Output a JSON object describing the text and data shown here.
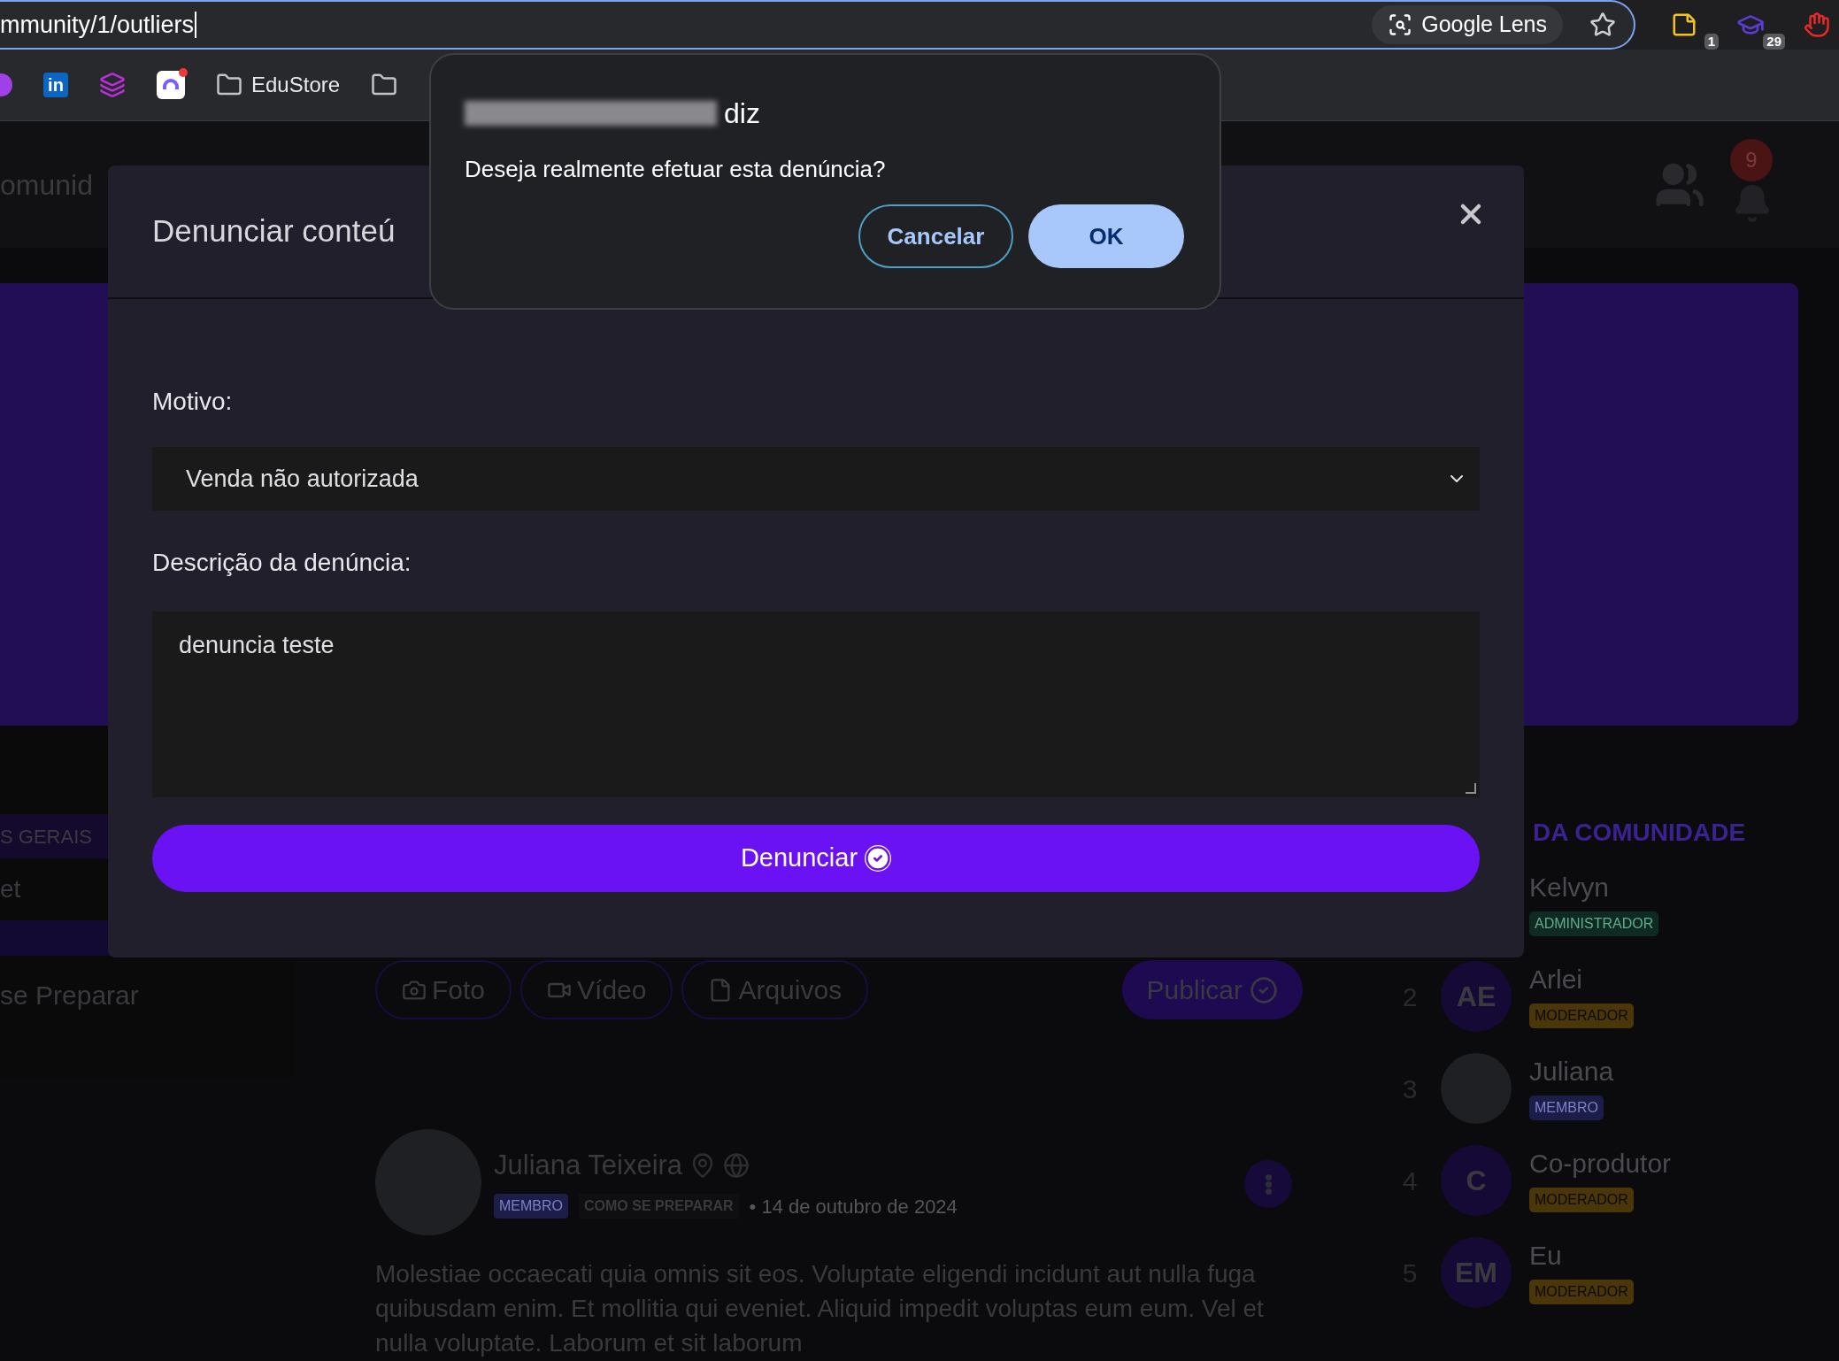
{
  "browser": {
    "url": "mmunity/1/outliers",
    "lens_label": "Google Lens",
    "extensions": [
      {
        "kind": "note",
        "badge": "1"
      },
      {
        "kind": "cap",
        "badge": "29"
      },
      {
        "kind": "hand"
      }
    ],
    "bookmarks": [
      {
        "kind": "circle"
      },
      {
        "kind": "linkedin",
        "label": "in"
      },
      {
        "kind": "layers"
      },
      {
        "kind": "clickup"
      },
      {
        "kind": "folder",
        "label": "EduStore"
      },
      {
        "kind": "folder"
      }
    ]
  },
  "header": {
    "title": "omunid",
    "notification_count": "9"
  },
  "left": {
    "section": "S GERAIS",
    "items": [
      {
        "label": "et",
        "selected": false
      },
      {
        "selected": true
      }
    ],
    "category": "se Preparar"
  },
  "composer": {
    "buttons": [
      {
        "kind": "photo",
        "label": "Foto"
      },
      {
        "kind": "video",
        "label": "Vídeo"
      },
      {
        "kind": "file",
        "label": "Arquivos"
      }
    ],
    "publish": "Publicar"
  },
  "post": {
    "author": "Juliana Teixeira",
    "role": "MEMBRO",
    "topic": "COMO SE PREPARAR",
    "date": "• 14 de outubro de 2024",
    "body": "Molestiae occaecati quia omnis sit eos. Voluptate eligendi incidunt aut nulla fuga quibusdam enim. Et mollitia qui eveniet. Aliquid impedit voluptas eum eum. Vel et nulla voluptate. Laborum et sit laborum"
  },
  "ranking": {
    "title": "DA COMUNIDADE",
    "members": [
      {
        "name": "Kelvyn",
        "role": "ADMINISTRADOR",
        "kind": "admin"
      },
      {
        "rank": "2",
        "initials": "AE",
        "name": "Arlei",
        "role": "MODERADOR",
        "kind": "moderator"
      },
      {
        "rank": "3",
        "name": "Juliana",
        "role": "MEMBRO",
        "kind": "member"
      },
      {
        "rank": "4",
        "initials": "C",
        "name": "Co-produtor",
        "role": "MODERADOR",
        "kind": "moderator"
      },
      {
        "rank": "5",
        "initials": "EM",
        "name": "Eu",
        "role": "MODERADOR",
        "kind": "moderator"
      }
    ]
  },
  "modal": {
    "title": "Denunciar conteú",
    "reason_label": "Motivo:",
    "reason_value": "Venda não autorizada",
    "description_label": "Descrição da denúncia:",
    "description_value": "denuncia teste",
    "submit": "Denunciar"
  },
  "alert": {
    "origin_suffix": "diz",
    "message": "Deseja realmente efetuar esta denúncia?",
    "buttons": [
      {
        "kind": "secondary",
        "label": "Cancelar"
      },
      {
        "kind": "primary",
        "label": "OK"
      }
    ]
  }
}
